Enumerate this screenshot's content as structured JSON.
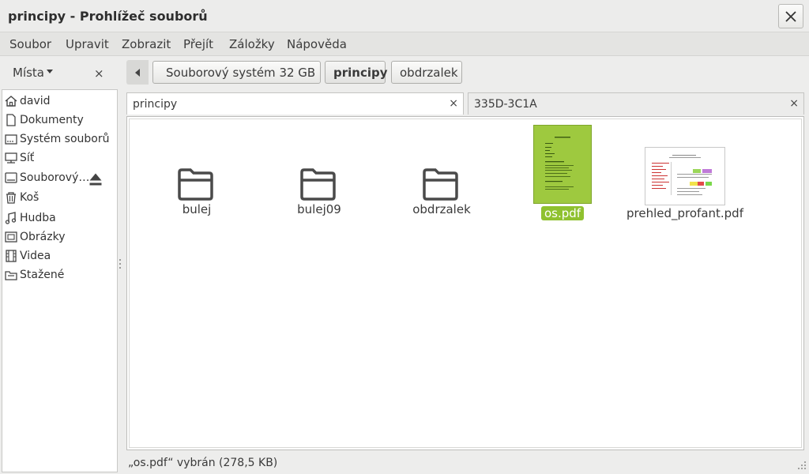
{
  "window": {
    "title": "principy - Prohlížeč souborů"
  },
  "menu": [
    "Soubor",
    "Upravit",
    "Zobrazit",
    "Přejít",
    "Záložky",
    "Nápověda"
  ],
  "sidebar": {
    "places_label": "Místa",
    "close": "×",
    "items": [
      {
        "label": "david",
        "icon": "home-icon"
      },
      {
        "label": "Dokumenty",
        "icon": "document-icon"
      },
      {
        "label": "Systém souborů",
        "icon": "filesystem-icon"
      },
      {
        "label": "Síť",
        "icon": "network-icon"
      },
      {
        "label": "Souborový…",
        "icon": "drive-icon",
        "eject": true
      },
      {
        "label": "Koš",
        "icon": "trash-icon"
      },
      {
        "label": "Hudba",
        "icon": "music-icon"
      },
      {
        "label": "Obrázky",
        "icon": "pictures-icon"
      },
      {
        "label": "Videa",
        "icon": "video-icon"
      },
      {
        "label": "Stažené",
        "icon": "downloads-icon"
      }
    ]
  },
  "pathbar": {
    "crumbs": [
      {
        "label": "Souborový systém 32 GB",
        "icon": "drive-icon"
      },
      {
        "label": "principy",
        "active": true
      },
      {
        "label": "obdrzalek"
      }
    ]
  },
  "tabs": [
    {
      "label": "principy",
      "active": true,
      "close": "×"
    },
    {
      "label": "335D-3C1A",
      "active": false,
      "close": "×"
    }
  ],
  "files": [
    {
      "name": "bulej",
      "type": "folder"
    },
    {
      "name": "bulej09",
      "type": "folder"
    },
    {
      "name": "obdrzalek",
      "type": "folder"
    },
    {
      "name": "os.pdf",
      "type": "pdf",
      "selected": true
    },
    {
      "name": "prehled_profant.pdf",
      "type": "pdf"
    }
  ],
  "statusbar": {
    "text": "„os.pdf“ vybrán (278,5 KB)"
  },
  "colors": {
    "selection": "#8fc12f",
    "thumb_selected": "#9ec93f"
  }
}
